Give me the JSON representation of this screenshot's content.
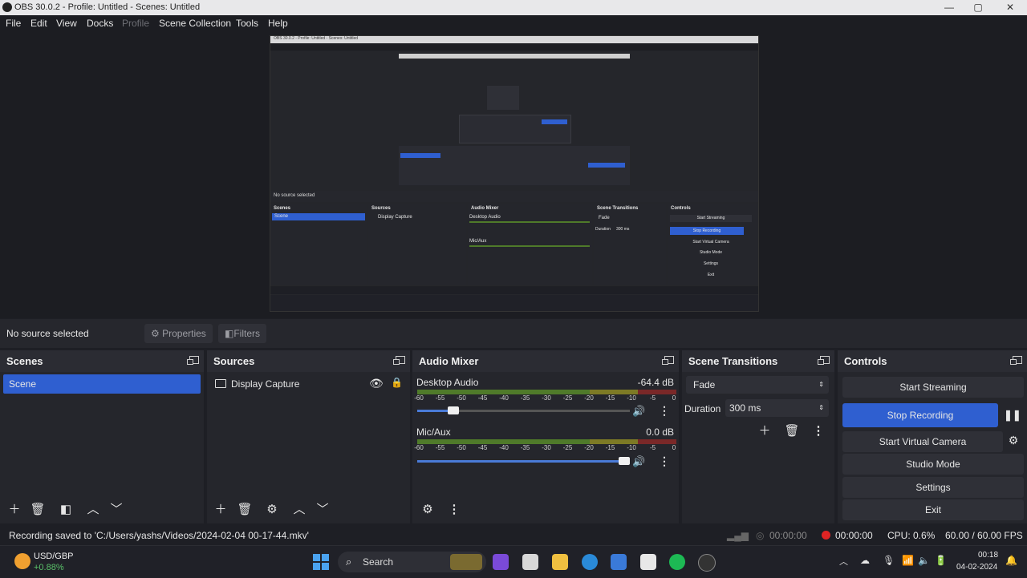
{
  "window": {
    "title": "OBS 30.0.2 - Profile: Untitled - Scenes: Untitled",
    "minimize": "—",
    "maximize": "▢",
    "close": "✕"
  },
  "menu": {
    "file": "File",
    "edit": "Edit",
    "view": "View",
    "docks": "Docks",
    "profile": "Profile",
    "scene_collection": "Scene Collection",
    "tools": "Tools",
    "help": "Help"
  },
  "source_bar": {
    "status": "No source selected",
    "properties": "Properties",
    "filters": "Filters"
  },
  "scenes": {
    "title": "Scenes",
    "items": [
      "Scene"
    ]
  },
  "sources": {
    "title": "Sources",
    "items": [
      "Display Capture"
    ]
  },
  "mixer": {
    "title": "Audio Mixer",
    "ticks": [
      "-60",
      "-55",
      "-50",
      "-45",
      "-40",
      "-35",
      "-30",
      "-25",
      "-20",
      "-15",
      "-10",
      "-5",
      "0"
    ],
    "channels": [
      {
        "name": "Desktop Audio",
        "db": "-64.4 dB",
        "volume": 0.15
      },
      {
        "name": "Mic/Aux",
        "db": "0.0 dB",
        "volume": 1.0
      }
    ]
  },
  "transitions": {
    "title": "Scene Transitions",
    "selected": "Fade",
    "duration_label": "Duration",
    "duration_value": "300 ms"
  },
  "controls": {
    "title": "Controls",
    "start_streaming": "Start Streaming",
    "stop_recording": "Stop Recording",
    "start_virtual_camera": "Start Virtual Camera",
    "studio_mode": "Studio Mode",
    "settings": "Settings",
    "exit": "Exit"
  },
  "status": {
    "message": "Recording saved to 'C:/Users/yashs/Videos/2024-02-04 00-17-44.mkv'",
    "stream_time": "00:00:00",
    "record_time": "00:00:00",
    "cpu": "CPU: 0.6%",
    "fps": "60.00 / 60.00 FPS"
  },
  "taskbar": {
    "ticker_name": "USD/GBP",
    "ticker_change": "+0.88%",
    "search": "Search",
    "time": "00:18",
    "date": "04-02-2024"
  },
  "preview_mini": {
    "title": "OBS 30.0.2 - Profile: Untitled - Scenes: Untitled",
    "no_source": "No source selected",
    "scenes": "Scenes",
    "scene": "Scene",
    "sources": "Sources",
    "display_capture": "Display Capture",
    "audio_mixer": "Audio Mixer",
    "desktop_audio": "Desktop Audio",
    "mic": "Mic/Aux",
    "transitions": "Scene Transitions",
    "controls": "Controls",
    "start_streaming": "Start Streaming",
    "stop_recording": "Stop Recording",
    "start_virtual_camera": "Start Virtual Camera",
    "studio_mode": "Studio Mode",
    "settings": "Settings",
    "exit": "Exit",
    "fade": "Fade",
    "duration": "Duration",
    "duration_value": "300 ms"
  },
  "colors": {
    "accent": "#2f5fd0",
    "record": "#e02424",
    "bg": "#1e1f25"
  }
}
